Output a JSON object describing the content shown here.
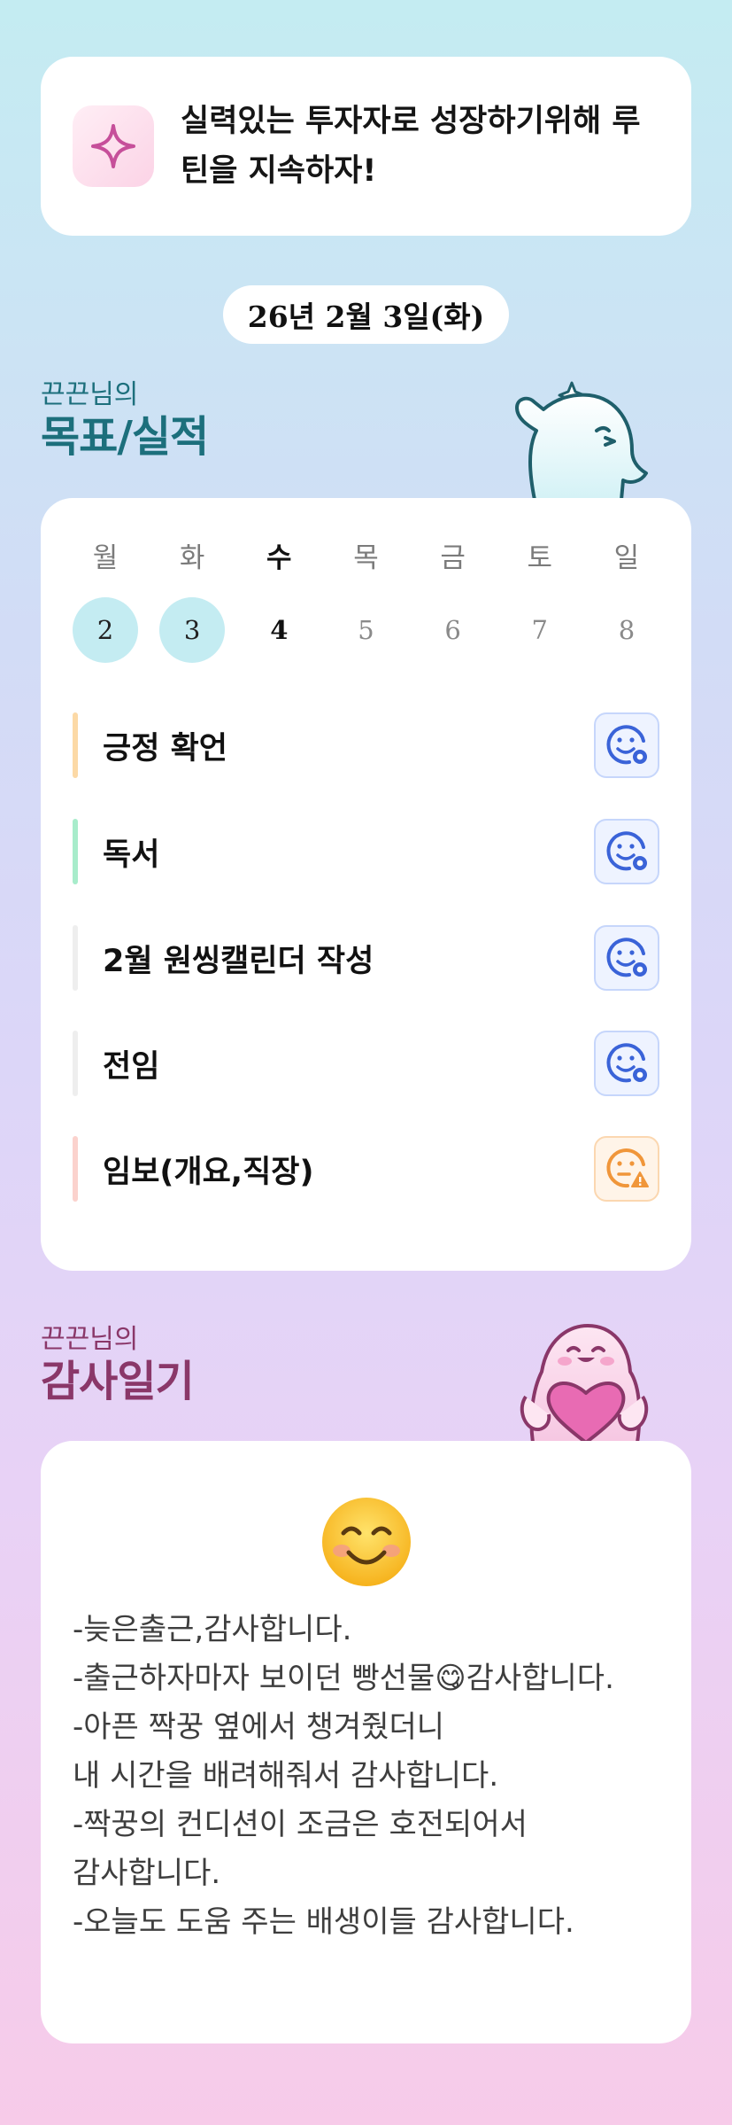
{
  "motto": {
    "text": "실력있는 투자자로 성장하기위해 루틴을 지속하자!",
    "icon": "sparkle-icon"
  },
  "date": "26년 2월 3일(화)",
  "goals_section": {
    "subtitle": "끈끈님의",
    "title": "목표/실적"
  },
  "week": [
    {
      "label": "월",
      "num": "2",
      "status": "done"
    },
    {
      "label": "화",
      "num": "3",
      "status": "done"
    },
    {
      "label": "수",
      "num": "4",
      "status": "today"
    },
    {
      "label": "목",
      "num": "5",
      "status": "future"
    },
    {
      "label": "금",
      "num": "6",
      "status": "future"
    },
    {
      "label": "토",
      "num": "7",
      "status": "future"
    },
    {
      "label": "일",
      "num": "8",
      "status": "future"
    }
  ],
  "goals": [
    {
      "label": "긍정 확언",
      "color": "#fcd9a6",
      "icon": "smile-clock-icon"
    },
    {
      "label": "독서",
      "color": "#a8eccb",
      "icon": "smile-clock-icon"
    },
    {
      "label": "2월 원씽캘린더 작성",
      "color": "#eeeeee",
      "icon": "smile-clock-icon"
    },
    {
      "label": "전임",
      "color": "#eeeeee",
      "icon": "smile-clock-icon"
    },
    {
      "label": "임보(개요,직장)",
      "color": "#fbd2cd",
      "icon": "smile-warning-icon"
    }
  ],
  "thanks_section": {
    "subtitle": "끈끈님의",
    "title": "감사일기"
  },
  "diary": {
    "emoji": "😊",
    "text": "-늦은출근,감사합니다.\n-출근하자마자 보이던 빵선물😋감사합니다.\n-아픈 짝꿍 옆에서 챙겨줬더니\n내 시간을 배려해줘서 감사합니다.\n-짝꿍의 컨디션이 조금은 호전되어서 감사합니다.\n-오늘도 도움 주는 배생이들 감사합니다."
  },
  "colors": {
    "accent_teal": "#1c6f7c",
    "accent_plum": "#8a3769",
    "done_day": "#c4ecf2",
    "icon_blue": "#3a63d8",
    "icon_orange": "#f0963a"
  }
}
